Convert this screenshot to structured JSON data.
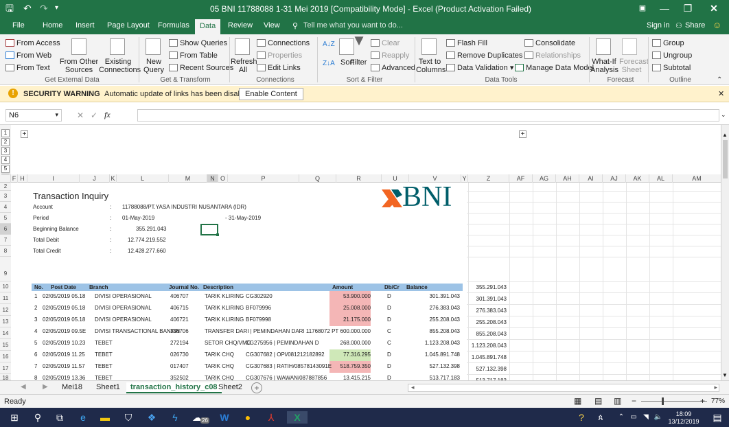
{
  "title_bar": {
    "title": "05 BNI 11788088 1-31 Mei 2019  [Compatibility Mode]  -  Excel (Product Activation Failed)",
    "save_icon": "save-icon",
    "undo_icon": "undo-icon",
    "redo_icon": "redo-icon"
  },
  "menu": {
    "tabs": [
      "File",
      "Home",
      "Insert",
      "Page Layout",
      "Formulas",
      "Data",
      "Review",
      "View"
    ],
    "active": "Data",
    "tell_me": "Tell me what you want to do...",
    "sign_in": "Sign in",
    "share": "Share"
  },
  "ribbon": {
    "get_external": {
      "items": [
        "From Access",
        "From Web",
        "From Text"
      ],
      "from_other": "From Other Sources",
      "existing": "Existing Connections",
      "label": "Get External Data"
    },
    "transform": {
      "new_query": "New Query",
      "show_queries": "Show Queries",
      "from_table": "From Table",
      "recent_sources": "Recent Sources",
      "label": "Get & Transform"
    },
    "connections": {
      "refresh": "Refresh All",
      "connections": "Connections",
      "properties": "Properties",
      "edit_links": "Edit Links",
      "label": "Connections"
    },
    "sort_filter": {
      "sort": "Sort",
      "filter": "Filter",
      "clear": "Clear",
      "reapply": "Reapply",
      "advanced": "Advanced",
      "label": "Sort & Filter"
    },
    "data_tools": {
      "text_to_columns": "Text to Columns",
      "flash_fill": "Flash Fill",
      "remove_duplicates": "Remove Duplicates",
      "data_validation": "Data Validation",
      "consolidate": "Consolidate",
      "relationships": "Relationships",
      "manage_model": "Manage Data Model",
      "label": "Data Tools"
    },
    "forecast": {
      "what_if": "What-If Analysis",
      "forecast_sheet": "Forecast Sheet",
      "label": "Forecast"
    },
    "outline": {
      "group": "Group",
      "ungroup": "Ungroup",
      "subtotal": "Subtotal",
      "label": "Outline"
    }
  },
  "security": {
    "title": "SECURITY WARNING",
    "message": "Automatic update of links has been disabled",
    "button": "Enable Content"
  },
  "formula_bar": {
    "name_box": "N6",
    "fx": "fx",
    "value": ""
  },
  "columns": [
    "F",
    "H",
    "I",
    "J",
    "K",
    "L",
    "M",
    "N",
    "O",
    "P",
    "Q",
    "R",
    "U",
    "V",
    "Y",
    "Z",
    "AF",
    "AG",
    "AH",
    "AI",
    "AJ",
    "AK",
    "AL",
    "AM"
  ],
  "outline_levels": [
    "1",
    "2",
    "3",
    "4",
    "5",
    "6"
  ],
  "rows": [
    "2",
    "3",
    "4",
    "5",
    "6",
    "7",
    "8",
    "9",
    "10",
    "11",
    "12",
    "13",
    "14",
    "15",
    "16",
    "17",
    "18"
  ],
  "sheet": {
    "heading": "Transaction Inquiry",
    "logo": "BNI",
    "fields": [
      {
        "label": "Account",
        "value": "11788088/PT.YASA INDUSTRI NUSANTARA (IDR)"
      },
      {
        "label": "Period",
        "value": "01-May-2019"
      },
      {
        "label": "Beginning Balance",
        "value": "355.291.043"
      },
      {
        "label": "Total Debit",
        "value": "12.774.219.552"
      },
      {
        "label": "Total Credit",
        "value": "12.428.277.660"
      }
    ],
    "period_end": "31-May-2019",
    "colon": ":",
    "headers": [
      "No.",
      "Post Date",
      "Branch",
      "Journal No.",
      "Description",
      "Amount",
      "Db/Cr",
      "Balance"
    ],
    "transactions": [
      [
        "1",
        "02/05/2019 05.18",
        "DIVISI OPERASIONAL",
        "406707",
        "TARIK KLIRING",
        "CG302920",
        "53.900.000",
        "D",
        "301.391.043"
      ],
      [
        "2",
        "02/05/2019 05.18",
        "DIVISI OPERASIONAL",
        "406715",
        "TARIK KLIRING",
        "BF079996",
        "25.008.000",
        "D",
        "276.383.043"
      ],
      [
        "3",
        "02/05/2019 05.18",
        "DIVISI OPERASIONAL",
        "406721",
        "TARIK KLIRING",
        "BF079998",
        "21.175.000",
        "D",
        "255.208.043"
      ],
      [
        "4",
        "02/05/2019 09.5E",
        "DIVISI TRANSACTIONAL BANKIN",
        "356706",
        "TRANSFER DARI | PEMINDAHAN DARI 11768072 PT",
        "",
        "600.000.000",
        "C",
        "855.208.043"
      ],
      [
        "5",
        "02/05/2019 10.23",
        "TEBET",
        "272194",
        "SETOR CHQ/VMG",
        "CG275956 | PEMINDAHAN D",
        "268.000.000",
        "C",
        "1.123.208.043"
      ],
      [
        "6",
        "02/05/2019 11.25",
        "TEBET",
        "026730",
        "TARIK CHQ",
        "CG307682 | OPI/081212182892",
        "77.316.295",
        "D",
        "1.045.891.748"
      ],
      [
        "7",
        "02/05/2019 11.57",
        "TEBET",
        "017407",
        "TARIK CHQ",
        "CG307683 | RATIH/08578143091E",
        "518.759.350",
        "D",
        "527.132.398"
      ],
      [
        "8",
        "02/05/2019 13.36",
        "TEBET",
        "352502",
        "TARIK CHQ",
        "CG307676 | WAWAN/087887856",
        "13.415.215",
        "D",
        "513.717.183"
      ]
    ],
    "side_balances": [
      "355.291.043",
      "301.391.043",
      "276.383.043",
      "255.208.043",
      "855.208.043",
      "1.123.208.043",
      "1.045.891.748",
      "527.132.398",
      "513.717.183"
    ]
  },
  "sheet_tabs": {
    "tabs": [
      "Mei18",
      "Sheet1",
      "transaction_history_c08",
      "Sheet2"
    ],
    "active": "transaction_history_c08"
  },
  "status": {
    "ready": "Ready",
    "zoom": "77%"
  },
  "taskbar": {
    "time": "18:09",
    "date": "13/12/2019",
    "badge": "26",
    "region": "ENG"
  },
  "colors": {
    "excel_green": "#217346",
    "header_fill": "#9dc3e6",
    "debit_fill": "#f4b6b6",
    "credit_fill": "#cfe8b8",
    "bni_orange": "#f26522",
    "bni_teal": "#005e6a"
  }
}
